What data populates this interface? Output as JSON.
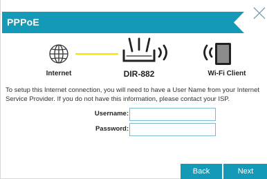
{
  "dialog": {
    "title": "PPPoE"
  },
  "diagram": {
    "internet_label": "Internet",
    "router_label": "DIR-882",
    "client_label": "Wi-Fi Client"
  },
  "description": "To setup this Internet connection, you will need to have a User Name from your Internet Service Provider. If you do not have this information, please contact your ISP.",
  "form": {
    "username_label": "Username:",
    "username_value": "",
    "password_label": "Password:",
    "password_value": ""
  },
  "buttons": {
    "back_label": "Back",
    "next_label": "Next"
  },
  "colors": {
    "accent": "#149ab6",
    "connection_line": "#f2e600",
    "input_border": "#7ab8cf"
  }
}
